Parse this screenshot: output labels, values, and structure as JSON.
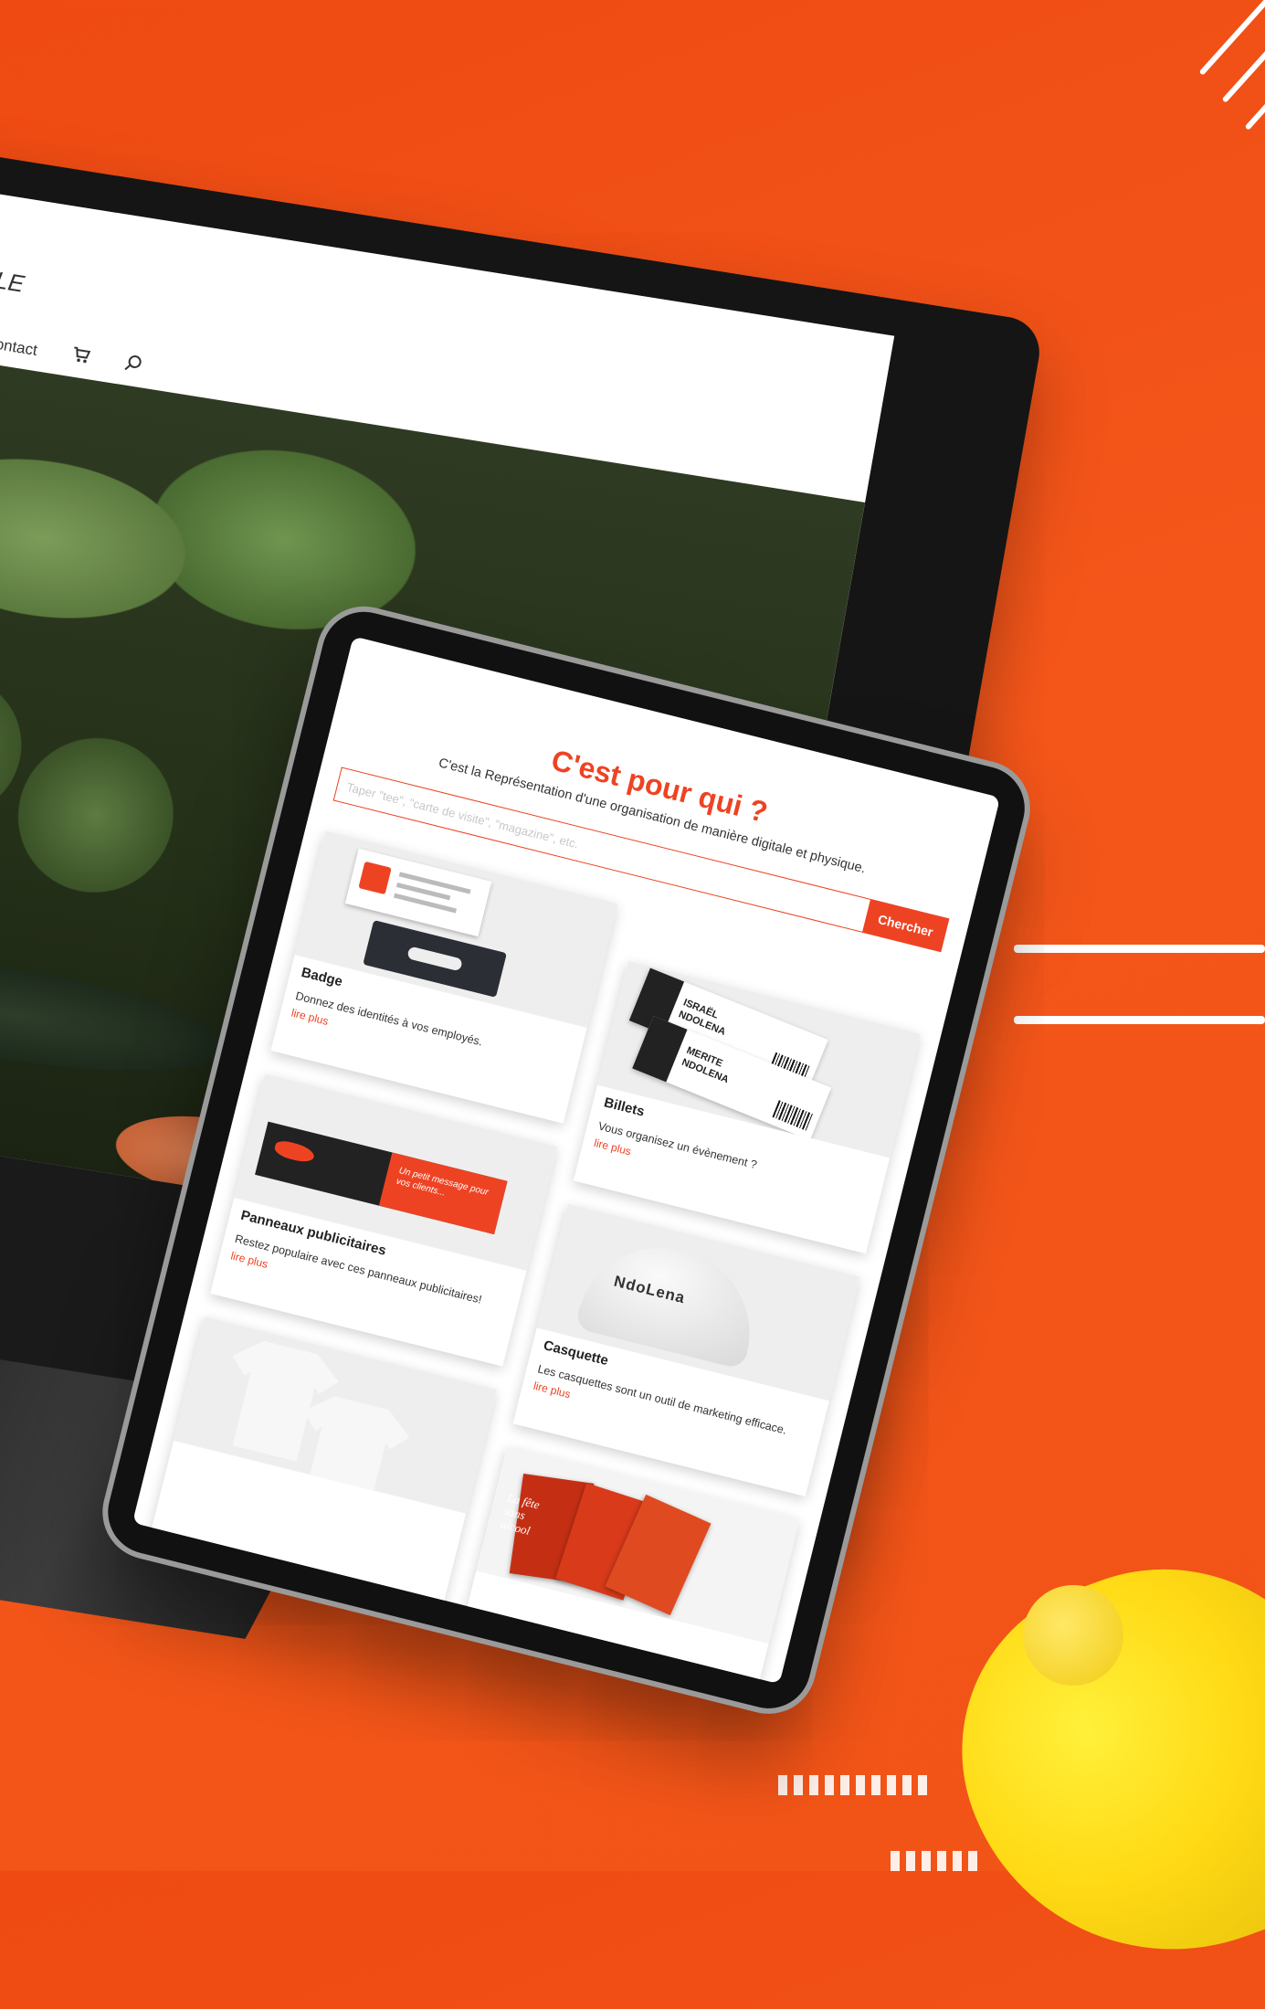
{
  "desktop": {
    "logo_fragment": "LE",
    "nav": {
      "contact_label": "Contact",
      "cart_icon": "cart-icon",
      "search_icon": "search-icon"
    }
  },
  "tablet": {
    "title": "C'est pour qui ?",
    "subtitle": "C'est la Représentation d'une organisation de manière digitale et physique.",
    "search": {
      "placeholder": "Taper \"tee\", \"carte de visite\", \"magazine\", etc.",
      "button_label": "Chercher"
    },
    "cards": [
      {
        "title": "Badge",
        "description": "Donnez des identités à vos employés.",
        "link": "lire plus"
      },
      {
        "title": "Billets",
        "description": "Vous organisez un évènement ?",
        "link": "lire plus"
      },
      {
        "title": "Panneaux publicitaires",
        "description": "Restez populaire avec ces panneaux publicitaires!",
        "link": "lire plus"
      },
      {
        "title": "Casquette",
        "description": "Les casquettes sont un outil de marketing efficace.",
        "link": "lire plus"
      }
    ],
    "art": {
      "ticket_1": "ISRAËL\nNDOLENA",
      "ticket_2": "MERITE\nNDOLENA",
      "banner_text": "Un petit message pour vos clients...",
      "cap_logo": "NdoLena",
      "flyer_text": "La fête\nsans\nalcool"
    }
  },
  "colors": {
    "background": "#f25417",
    "accent": "#ee4323",
    "yellow": "#ffd914"
  }
}
